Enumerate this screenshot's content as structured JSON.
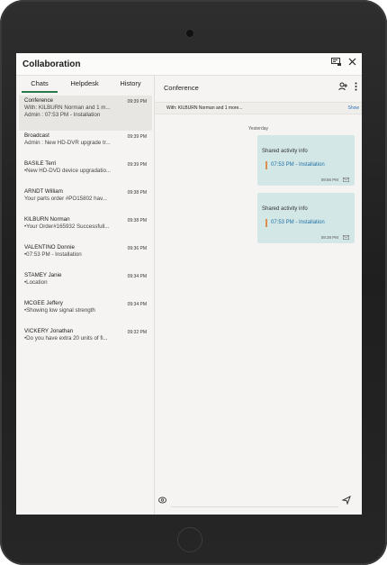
{
  "app": {
    "title": "Collaboration"
  },
  "tabs": [
    {
      "label": "Chats",
      "active": true
    },
    {
      "label": "Helpdesk",
      "active": false
    },
    {
      "label": "History",
      "active": false
    }
  ],
  "conversations": [
    {
      "name": "Conference",
      "line2": "With: KILBURN Norman and 1 m...",
      "line3": "Admin : 07:53 PM - Installation",
      "time": "09:39 PM",
      "selected": true
    },
    {
      "name": "Broadcast",
      "line2": "Admin : New HD-DVR upgrade tr...",
      "time": "09:39 PM"
    },
    {
      "name": "BASILE Terri",
      "line2": "•New HD-DVD device upgradatio...",
      "time": "09:39 PM"
    },
    {
      "name": "ARNDT William",
      "line2": " Your parts order #PO15802 hav...",
      "time": "09:38 PM"
    },
    {
      "name": "KILBURN Norman",
      "line2": "•Your Order#165932 Successfull...",
      "time": "09:38 PM"
    },
    {
      "name": "VALENTINO Donnie",
      "line2": "•07:53 PM - Installation",
      "time": "09:36 PM"
    },
    {
      "name": "STAMEY Janie",
      "line2": "•Location",
      "time": "09:34 PM"
    },
    {
      "name": "MCGEE Jeffery",
      "line2": "•Showing low signal strength",
      "time": "09:34 PM"
    },
    {
      "name": "VICKERY Jonathan",
      "line2": "•Do you have extra 20 units of fi...",
      "time": "09:32 PM"
    }
  ],
  "conversation_view": {
    "title": "Conference",
    "participants": "With: KILBURN Norman and 1 more...",
    "show_label": "Show",
    "day_separator": "Yesterday",
    "messages": [
      {
        "title": "Shared activity info",
        "link": "07:53 PM - Installation",
        "time": "09:56 PM"
      },
      {
        "title": "Shared activity info",
        "link": "07:53 PM - Installation",
        "time": "09:39 PM"
      }
    ]
  },
  "composer": {
    "placeholder": ""
  },
  "icons": {
    "titlebar": [
      "screen-share-icon",
      "close-icon"
    ],
    "header": [
      "add-person-icon",
      "more-vertical-icon"
    ],
    "composer": [
      "attachment-icon",
      "send-icon"
    ],
    "message": "envelope-icon"
  },
  "colors": {
    "accent_tab": "#2b7a4b",
    "bubble": "#d3e7e6",
    "link": "#1f6fa3",
    "link_marker": "#d98f4d"
  }
}
